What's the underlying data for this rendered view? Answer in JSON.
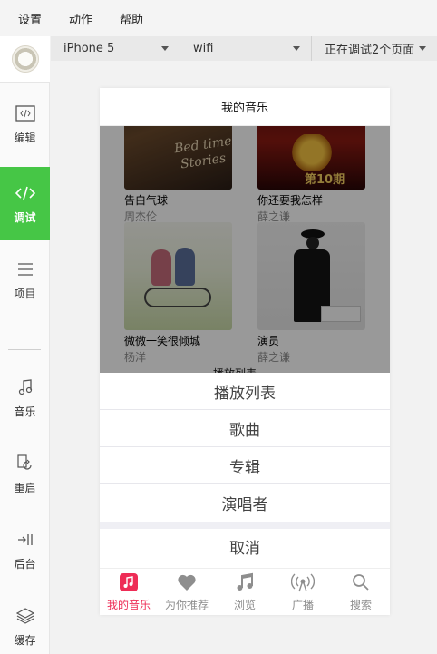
{
  "menubar": {
    "items": [
      "设置",
      "动作",
      "帮助"
    ]
  },
  "sidebar": {
    "items": [
      {
        "label": "编辑",
        "icon": "code-box-icon"
      },
      {
        "label": "调试",
        "icon": "code-icon"
      },
      {
        "label": "项目",
        "icon": "menu-icon"
      },
      {
        "label": "音乐",
        "icon": "music-note-icon"
      },
      {
        "label": "重启",
        "icon": "restart-icon"
      },
      {
        "label": "后台",
        "icon": "background-icon"
      },
      {
        "label": "缓存",
        "icon": "layers-icon"
      }
    ],
    "active_color": "#46c646"
  },
  "devbar": {
    "device": "iPhone 5",
    "network": "wifi",
    "pages": "正在调试2个页面"
  },
  "phone": {
    "title": "我的音乐",
    "albums": [
      {
        "title": "告白气球",
        "artist": "周杰伦"
      },
      {
        "title": "你还要我怎样",
        "artist": "薛之谦"
      },
      {
        "title": "微微一笑很倾城",
        "artist": "杨洋"
      },
      {
        "title": "演员",
        "artist": "薛之谦"
      }
    ],
    "peek_text": "播放列表 ⌄",
    "sheet": {
      "items": [
        "播放列表",
        "歌曲",
        "专辑",
        "演唱者"
      ],
      "cancel": "取消"
    },
    "tabs": [
      {
        "label": "我的音乐",
        "icon": "music-library-icon"
      },
      {
        "label": "为你推荐",
        "icon": "heart-icon"
      },
      {
        "label": "浏览",
        "icon": "music-notes-icon"
      },
      {
        "label": "广播",
        "icon": "radio-icon"
      },
      {
        "label": "搜索",
        "icon": "search-icon"
      }
    ],
    "accent": "#ee2c56"
  }
}
